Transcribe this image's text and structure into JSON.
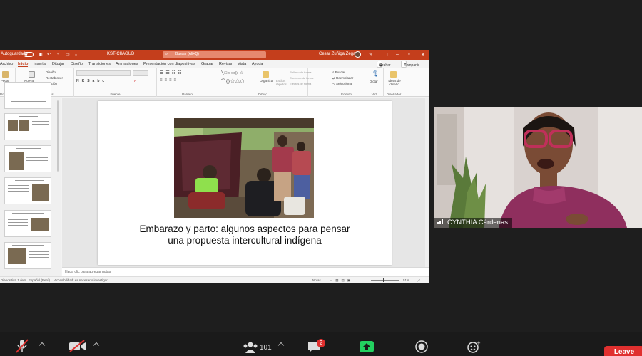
{
  "window": {
    "autosave_label": "Autoguardado",
    "file_name": "KST-CIIAGUD",
    "search_placeholder": "Buscar (Alt+Q)",
    "user_name": "Cesar Zuñiga Zegarra"
  },
  "menu": {
    "tabs": [
      "Archivo",
      "Inicio",
      "Insertar",
      "Dibujar",
      "Diseño",
      "Transiciones",
      "Animaciones",
      "Presentación con diapositivas",
      "Grabar",
      "Revisar",
      "Vista",
      "Ayuda"
    ],
    "active_tab": "Inicio",
    "record_button": "Grabar",
    "share_button": "Compartir"
  },
  "ribbon": {
    "paste": "Pegar",
    "clipboard_group": "Portapapeles",
    "new_slide": "Nueva diapositiva",
    "layout": "Diseño",
    "reset": "Restablecer",
    "section": "Sección",
    "slides_group": "Diapositivas",
    "font_group": "Fuente",
    "paragraph_group": "Párrafo",
    "arrange": "Organizar",
    "quick_styles": "Estilos rápidos",
    "shape_fill": "Relleno de forma",
    "shape_outline": "Contorno de forma",
    "shape_effects": "Efectos de forma",
    "drawing_group": "Dibujo",
    "find": "Buscar",
    "replace": "Reemplazar",
    "select": "Seleccionar",
    "editing_group": "Edición",
    "dictate": "Dictar",
    "voice_group": "Voz",
    "designer": "Ideas de diseño",
    "designer_group": "Diseñador"
  },
  "slide": {
    "title_line1": "Embarazo y parto: algunos aspectos para pensar",
    "title_line2": "una propuesta intercultural indígena"
  },
  "notes_placeholder": "Haga clic para agregar notas",
  "status": {
    "slide_counter": "Diapositiva 1 de 8",
    "language": "Español (Perú)",
    "accessibility": "Accesibilidad: es necesario investigar",
    "notes_button": "Notas",
    "zoom": "51%"
  },
  "participant": {
    "name": "CYNTHIA Cárdenas"
  },
  "toolbar": {
    "participants_count": "101",
    "chat_badge": "2",
    "leave_label": "Leave"
  }
}
